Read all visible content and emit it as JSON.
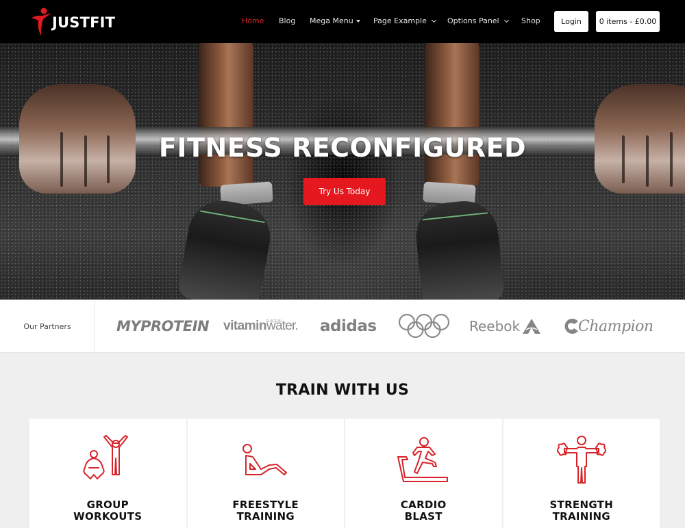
{
  "header": {
    "logo_text": "JUSTFIT",
    "nav": [
      {
        "label": "Home",
        "active": true,
        "dropdown": "none"
      },
      {
        "label": "Blog",
        "active": false,
        "dropdown": "none"
      },
      {
        "label": "Mega Menu",
        "active": false,
        "dropdown": "caret"
      },
      {
        "label": "Page Example",
        "active": false,
        "dropdown": "chevron"
      },
      {
        "label": "Options Panel",
        "active": false,
        "dropdown": "chevron"
      },
      {
        "label": "Shop",
        "active": false,
        "dropdown": "none"
      }
    ],
    "login_label": "Login",
    "cart_label": "0 items - £0.00"
  },
  "hero": {
    "title": "FITNESS RECONFIGURED",
    "cta_label": "Try Us Today"
  },
  "partners": {
    "label": "Our Partners",
    "logos": [
      "MYPROTEIN",
      "vitaminwater",
      "adidas",
      "Olympic Rings",
      "Reebok",
      "Champion"
    ],
    "vitamin_bold": "vitamin",
    "vitamin_light": "water.",
    "vitamin_small": "GLACEAU",
    "reebok_text": "Reebok",
    "champion_text": "Champion"
  },
  "train": {
    "title": "TRAIN WITH US",
    "cards": [
      {
        "title_line1": "GROUP",
        "title_line2": "WORKOUTS",
        "icon": "group-workout-icon"
      },
      {
        "title_line1": "FREESTYLE",
        "title_line2": "TRAINING",
        "icon": "situp-icon"
      },
      {
        "title_line1": "CARDIO",
        "title_line2": "BLAST",
        "icon": "treadmill-runner-icon"
      },
      {
        "title_line1": "STRENGTH",
        "title_line2": "TRAINING",
        "icon": "dumbbell-lifter-icon"
      }
    ]
  },
  "colors": {
    "accent": "#e5181f",
    "nav_active": "#d8232a",
    "header_bg": "#000000",
    "page_bg": "#efefef",
    "icon_stroke": "#d8232a"
  }
}
